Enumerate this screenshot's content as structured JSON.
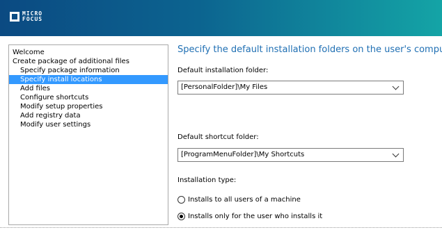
{
  "brand": {
    "logo_line1": "MICRO",
    "logo_line2": "FOCUS"
  },
  "nav": {
    "items": [
      {
        "label": "Welcome",
        "level": 0
      },
      {
        "label": "Create package of additional files",
        "level": 0
      },
      {
        "label": "Specify package information",
        "level": 1
      },
      {
        "label": "Specify install locations",
        "level": 1,
        "selected": true
      },
      {
        "label": "Add files",
        "level": 1
      },
      {
        "label": "Configure shortcuts",
        "level": 1
      },
      {
        "label": "Modify setup properties",
        "level": 1
      },
      {
        "label": "Add registry data",
        "level": 1
      },
      {
        "label": "Modify user settings",
        "level": 1
      }
    ]
  },
  "main": {
    "heading": "Specify the default installation folders on the user's computer",
    "install_folder": {
      "label": "Default installation folder:",
      "value": "[PersonalFolder]\\My Files"
    },
    "shortcut_folder": {
      "label": "Default shortcut folder:",
      "value": "[ProgramMenuFolder]\\My Shortcuts"
    },
    "install_type": {
      "label": "Installation type:",
      "options": [
        {
          "label": "Installs to all users of a machine",
          "checked": false
        },
        {
          "label": "Installs only for the user who installs it",
          "checked": true
        }
      ]
    }
  },
  "colors": {
    "header_left": "#0b4a82",
    "header_right": "#14a4a6",
    "heading": "#1f6fb3",
    "selection": "#3399ff"
  }
}
